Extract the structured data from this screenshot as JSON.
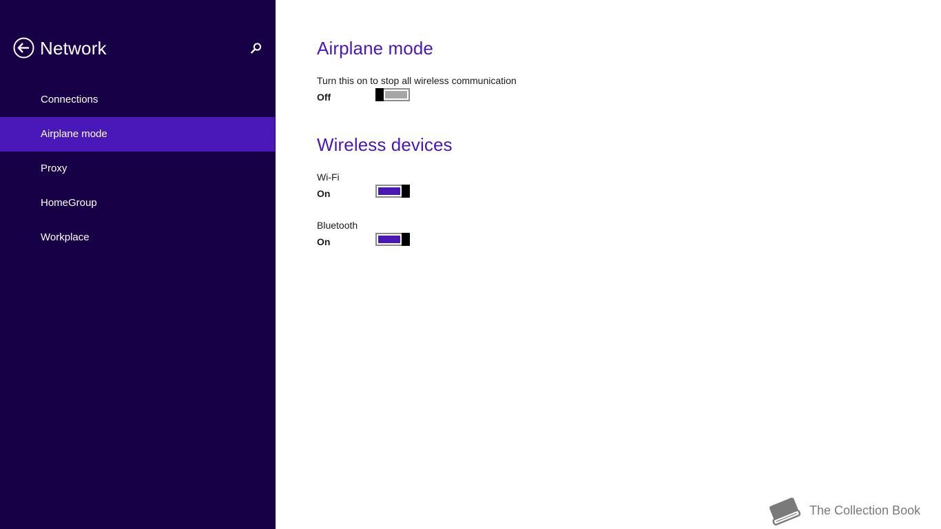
{
  "sidebar": {
    "title": "Network",
    "back_icon": "back-arrow-circle-icon",
    "search_icon": "search-icon",
    "items": [
      {
        "label": "Connections",
        "selected": false
      },
      {
        "label": "Airplane mode",
        "selected": true
      },
      {
        "label": "Proxy",
        "selected": false
      },
      {
        "label": "HomeGroup",
        "selected": false
      },
      {
        "label": "Workplace",
        "selected": false
      }
    ]
  },
  "main": {
    "airplane": {
      "title": "Airplane mode",
      "description": "Turn this on to stop all wireless communication",
      "state": "Off",
      "on": false
    },
    "wireless": {
      "title": "Wireless devices",
      "wifi": {
        "label": "Wi-Fi",
        "state": "On",
        "on": true
      },
      "bluetooth": {
        "label": "Bluetooth",
        "state": "On",
        "on": true
      }
    }
  },
  "watermark": {
    "text": "The Collection Book",
    "icon": "book-icon"
  },
  "colors": {
    "sidebar_bg": "#180046",
    "accent": "#4a18b8",
    "toggle_off_track": "#a6a6a6"
  }
}
